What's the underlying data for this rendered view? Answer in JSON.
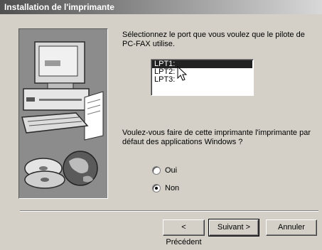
{
  "window": {
    "title": "Installation de l'imprimante"
  },
  "art": {
    "description_icon": "printer-computer-cd-illustration"
  },
  "port": {
    "prompt": "Sélectionnez le port que vous voulez que le pilote de PC-FAX utilise.",
    "options": [
      "LPT1:",
      "LPT2:",
      "LPT3:"
    ],
    "selected": "LPT1:"
  },
  "default_printer": {
    "prompt": "Voulez-vous faire de cette imprimante l'imprimante par défaut des applications Windows ?",
    "options": [
      {
        "label": "Oui",
        "checked": false
      },
      {
        "label": "Non",
        "checked": true
      }
    ]
  },
  "buttons": {
    "back": "< Précédent",
    "next": "Suivant >",
    "cancel": "Annuler"
  }
}
